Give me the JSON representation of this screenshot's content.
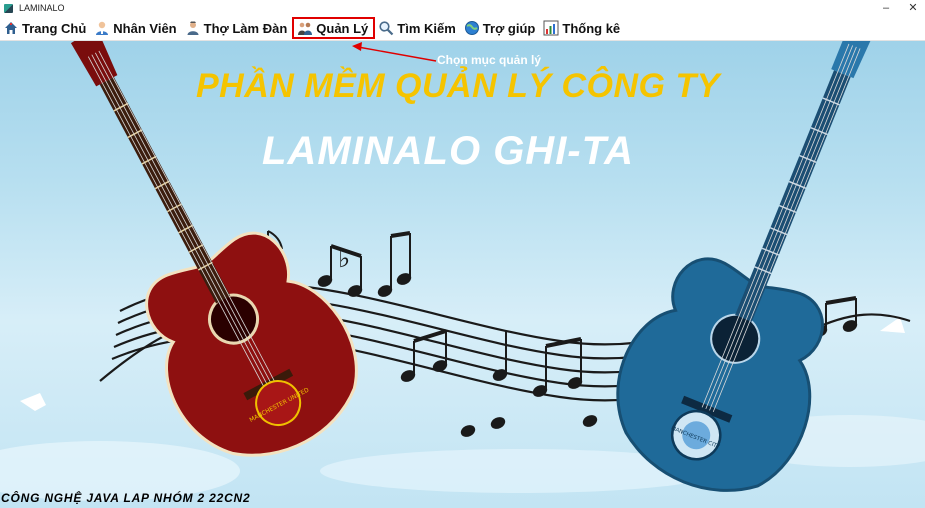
{
  "window": {
    "title": "LAMINALO",
    "minimize": "–",
    "close": "✕"
  },
  "menu": {
    "items": [
      {
        "label": "Trang Chủ",
        "icon": "home-icon"
      },
      {
        "label": "Nhân Viên",
        "icon": "employee-icon"
      },
      {
        "label": "Thợ Làm Đàn",
        "icon": "craftsman-icon"
      },
      {
        "label": "Quản Lý",
        "icon": "management-icon",
        "selected": true
      },
      {
        "label": "Tìm Kiếm",
        "icon": "search-icon"
      },
      {
        "label": "Trợ giúp",
        "icon": "help-globe-icon"
      },
      {
        "label": "Thống kê",
        "icon": "statistics-icon"
      }
    ]
  },
  "annotation": {
    "text": "Chọn mục quản lý",
    "color": "#e00000"
  },
  "banner": {
    "title": "PHẦN MỀM QUẢN LÝ CÔNG TY",
    "subtitle": "LAMINALO GHI-TA",
    "footer": "CÔNG NGHỆ JAVA LAP NHÓM 2 22CN2",
    "left_crest_text": "MANCHESTER UNITED",
    "right_crest_text": "MANCHESTER CITY"
  },
  "colors": {
    "title_yellow": "#f5c400",
    "sky": "#b7dff0",
    "red_guitar": "#8e1010",
    "blue_guitar": "#1f6a99"
  }
}
